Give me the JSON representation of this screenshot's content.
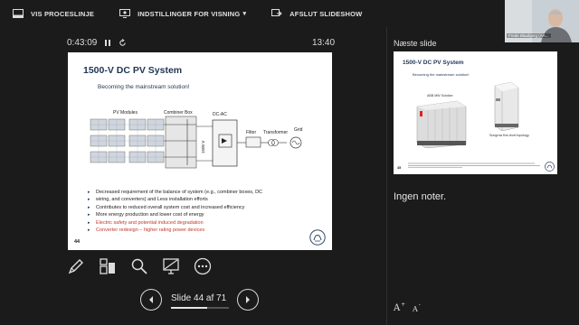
{
  "toolbar": {
    "items": [
      {
        "label": "VIS PROCESLINJE",
        "icon": "taskbar-icon"
      },
      {
        "label": "INDSTILLINGER FOR VISNING",
        "icon": "display-settings-icon",
        "caret": "▾"
      },
      {
        "label": "AFSLUT SLIDESHOW",
        "icon": "end-slideshow-icon"
      }
    ]
  },
  "presenter": {
    "elapsed": "0:43:09",
    "clock": "13:40",
    "pause_icon": "pause-icon",
    "restart_icon": "restart-timer-icon"
  },
  "current_slide": {
    "title": "1500-V DC PV System",
    "subtitle": "Becoming the mainstream solution!",
    "diagram_labels": {
      "pv_modules": "PV Modules",
      "combiner_box": "Combiner Box",
      "dc_ac": "DC-AC",
      "voltage": "1500 V",
      "filter": "Filter",
      "transformer": "Transformer",
      "grid": "Grid"
    },
    "bullets": [
      {
        "text": "Decreased requirement of the balance of system (e.g., combiner boxes, DC",
        "red": false
      },
      {
        "text": "wiring, and converters) and Less installation efforts",
        "red": false,
        "continuation": true
      },
      {
        "text": "Contributes to reduced overall system cost and increased efficiency",
        "red": false
      },
      {
        "text": "More energy production and lower cost of energy",
        "red": false
      },
      {
        "text": "Electric safety and potential induced degradation",
        "red": true
      },
      {
        "text": "Converter redesign – higher rating power devices",
        "red": true
      }
    ],
    "number": "44"
  },
  "tools": [
    {
      "name": "pen-tool",
      "icon": "pen-icon"
    },
    {
      "name": "see-all-slides",
      "icon": "slides-grid-icon"
    },
    {
      "name": "zoom-into-slide",
      "icon": "magnifier-icon"
    },
    {
      "name": "black-screen",
      "icon": "screen-black-icon"
    },
    {
      "name": "more-options",
      "icon": "more-options-icon"
    }
  ],
  "navigation": {
    "counter": "Slide 44 af 71",
    "progress": 0.62
  },
  "next_slide": {
    "label": "Næste slide",
    "title": "1500-V DC PV System",
    "subtitle": "Becoming the mainstream solution!",
    "caption_left": "ABB MW Solution",
    "caption_right": "Sungrow five-level topology",
    "number": "45"
  },
  "notes": {
    "text": "Ingen noter."
  },
  "webcam": {
    "name": "Frede Blaabjerg (AA..."
  },
  "font_controls": {
    "increase_label": "A",
    "increase_sign": "+",
    "decrease_label": "A",
    "decrease_sign": "-"
  },
  "colors": {
    "background": "#1b1b1b",
    "slide_title": "#1f3553",
    "red_bullet": "#c0392b"
  }
}
